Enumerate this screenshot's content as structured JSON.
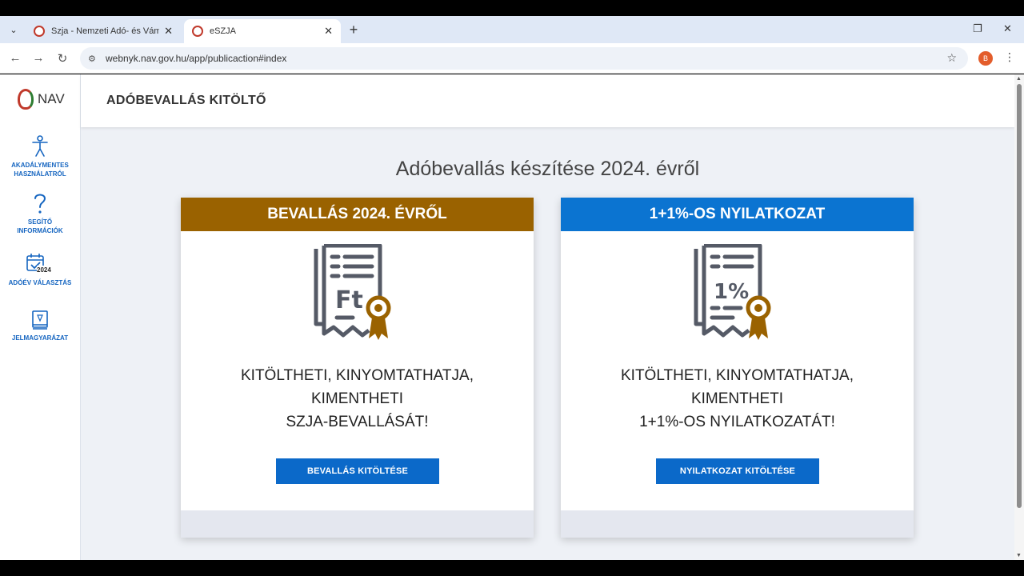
{
  "browser": {
    "tabs": [
      {
        "title": "Szja - Nemzeti Adó- és Vámhiva",
        "active": false
      },
      {
        "title": "eSZJA",
        "active": true
      }
    ],
    "url": "webnyk.nav.gov.hu/app/publicaction#index",
    "profile_initial": "B"
  },
  "sidebar": {
    "logo_text": "NAV",
    "items": [
      {
        "label_line1": "AKADÁLYMENTES",
        "label_line2": "HASZNÁLATRÓL",
        "icon": "accessibility-icon"
      },
      {
        "label_line1": "SEGÍTŐ",
        "label_line2": "INFORMÁCIÓK",
        "icon": "question-icon"
      },
      {
        "label_line1": "ADÓÉV VÁLASZTÁS",
        "label_line2": "",
        "icon": "calendar-icon",
        "badge": "2024"
      },
      {
        "label_line1": "JELMAGYARÁZAT",
        "label_line2": "",
        "icon": "book-icon"
      }
    ]
  },
  "header": {
    "title": "ADÓBEVALLÁS KITÖLTŐ"
  },
  "main": {
    "heading": "Adóbevallás készítése 2024. évről",
    "cards": [
      {
        "title": "BEVALLÁS 2024. ÉVRŐL",
        "icon_text": "Ft",
        "line1": "KITÖLTHETI, KINYOMTATHATJA,",
        "line2": "KIMENTHETI",
        "line3": "SZJA-BEVALLÁSÁT!",
        "button": "BEVALLÁS KITÖLTÉSE"
      },
      {
        "title": "1+1%-OS NYILATKOZAT",
        "icon_text": "1%",
        "line1": "KITÖLTHETI, KINYOMTATHATJA,",
        "line2": "KIMENTHETI",
        "line3": "1+1%-OS NYILATKOZATÁT!",
        "button": "NYILATKOZAT KITÖLTÉSE"
      }
    ]
  },
  "colors": {
    "accent_brown": "#9a6200",
    "accent_blue": "#0b74d1",
    "link_blue": "#1565c0"
  }
}
